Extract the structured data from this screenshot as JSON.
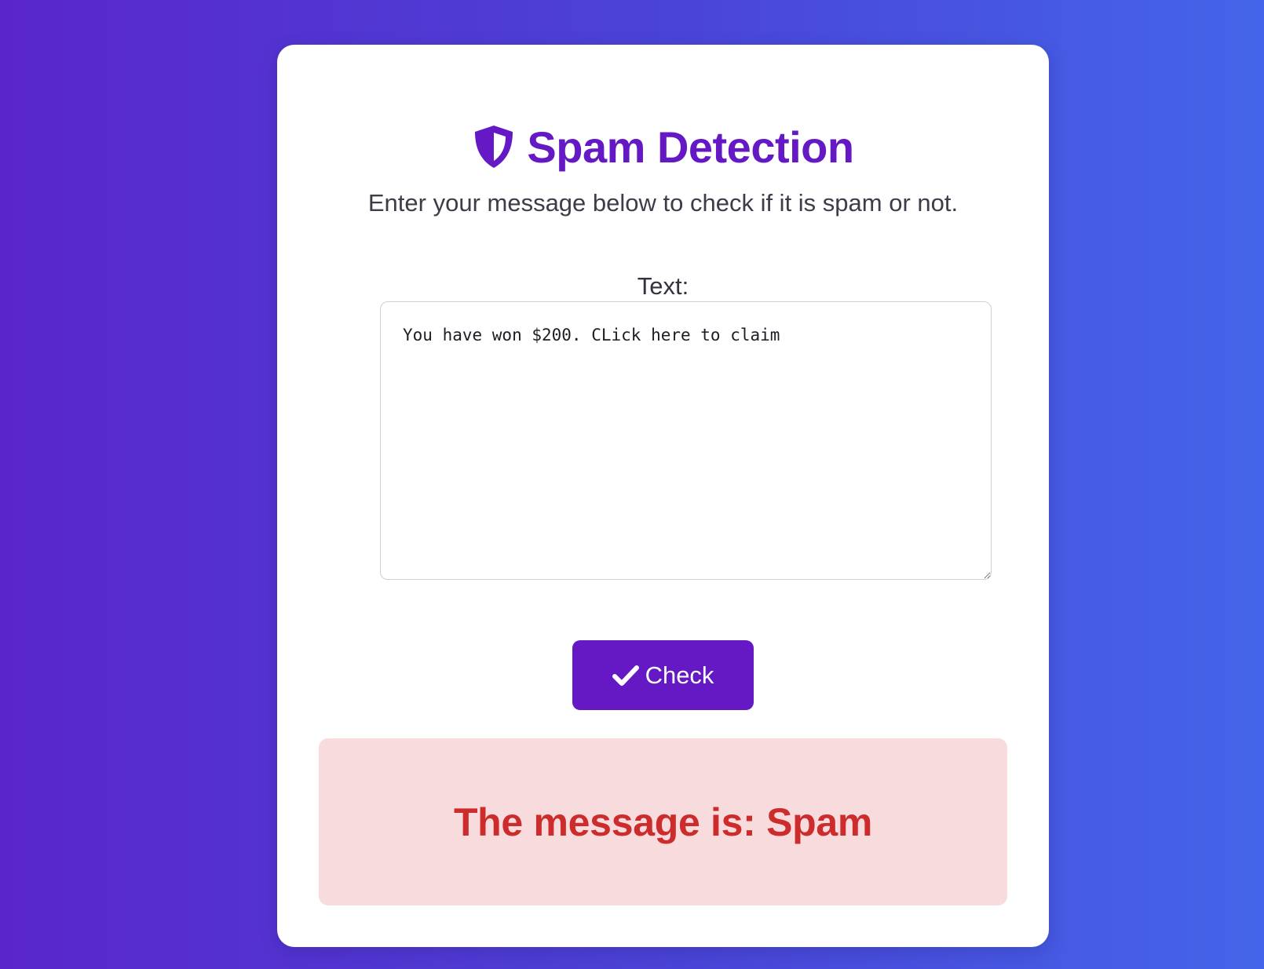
{
  "header": {
    "title": "Spam Detection",
    "icon": "shield-icon",
    "subtitle": "Enter your message below to check if it is spam or not."
  },
  "form": {
    "text_label": "Text:",
    "text_value": "You have won $200. CLick here to claim",
    "check_button_label": "Check",
    "check_button_icon": "check-icon"
  },
  "result": {
    "message": "The message is: Spam"
  },
  "colors": {
    "accent": "#6419c4",
    "result_background": "#f8dcdd",
    "result_text": "#cc2c2c"
  }
}
